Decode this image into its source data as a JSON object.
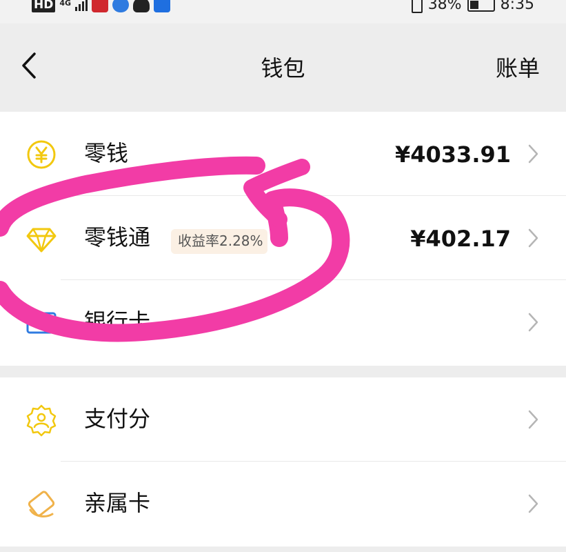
{
  "status_bar": {
    "hd": "HD",
    "network": "4G",
    "battery_percent": "38%",
    "time": "8:35"
  },
  "nav": {
    "title": "钱包",
    "right_action": "账单"
  },
  "rows": [
    {
      "label": "零钱",
      "value": "¥4033.91",
      "icon": "yuan-coin-icon"
    },
    {
      "label": "零钱通",
      "badge": "收益率2.28%",
      "value": "¥402.17",
      "icon": "diamond-icon"
    },
    {
      "label": "银行卡",
      "value": "",
      "icon": "bank-card-icon"
    },
    {
      "label": "支付分",
      "value": "",
      "icon": "credit-score-badge-icon"
    },
    {
      "label": "亲属卡",
      "value": "",
      "icon": "family-card-icon"
    }
  ],
  "colors": {
    "accent_yellow": "#f2c80f",
    "scribble_pink": "#f23ca6",
    "background": "#ededed",
    "card": "#ffffff"
  }
}
